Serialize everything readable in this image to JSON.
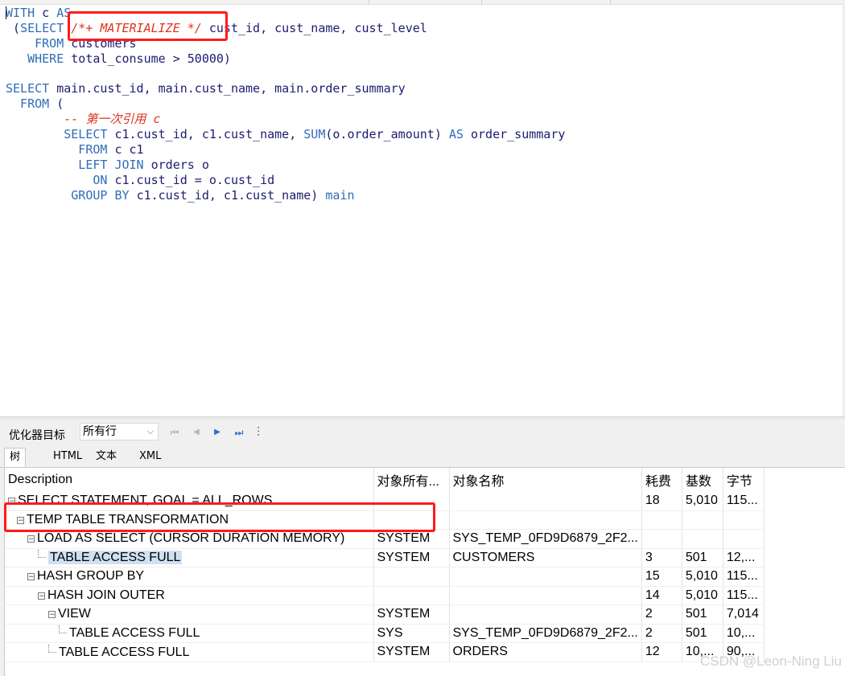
{
  "editor": {
    "lines": [
      [
        {
          "t": "WITH ",
          "c": "kw"
        },
        {
          "t": "c ",
          "c": "id"
        },
        {
          "t": "AS",
          "c": "kw"
        }
      ],
      [
        {
          "t": " (",
          "c": "id"
        },
        {
          "t": "SELECT ",
          "c": "kw"
        },
        {
          "t": "/*+ MATERIALIZE */",
          "c": "cm"
        },
        {
          "t": " cust_id, cust_name, cust_level",
          "c": "id"
        }
      ],
      [
        {
          "t": "    FROM ",
          "c": "kw"
        },
        {
          "t": "customers",
          "c": "id"
        }
      ],
      [
        {
          "t": "   WHERE ",
          "c": "kw"
        },
        {
          "t": "total_consume > 50000)",
          "c": "id"
        }
      ],
      [
        {
          "t": "",
          "c": "id"
        }
      ],
      [
        {
          "t": "SELECT ",
          "c": "kw"
        },
        {
          "t": "main.cust_id, main.cust_name, main.order_summary",
          "c": "id"
        }
      ],
      [
        {
          "t": "  FROM ",
          "c": "kw"
        },
        {
          "t": "(",
          "c": "id"
        }
      ],
      [
        {
          "t": "        -- 第一次引用 c",
          "c": "cm"
        }
      ],
      [
        {
          "t": "        SELECT ",
          "c": "kw"
        },
        {
          "t": "c1.cust_id, c1.cust_name, ",
          "c": "id"
        },
        {
          "t": "SUM",
          "c": "fn"
        },
        {
          "t": "(o.order_amount) ",
          "c": "id"
        },
        {
          "t": "AS ",
          "c": "kw"
        },
        {
          "t": "order_summary",
          "c": "id"
        }
      ],
      [
        {
          "t": "          FROM ",
          "c": "kw"
        },
        {
          "t": "c c1",
          "c": "id"
        }
      ],
      [
        {
          "t": "          LEFT JOIN ",
          "c": "kw"
        },
        {
          "t": "orders o",
          "c": "id"
        }
      ],
      [
        {
          "t": "            ON ",
          "c": "kw"
        },
        {
          "t": "c1.cust_id = o.cust_id",
          "c": "id"
        }
      ],
      [
        {
          "t": "         GROUP BY ",
          "c": "kw"
        },
        {
          "t": "c1.cust_id, c1.cust_name) ",
          "c": "id"
        },
        {
          "t": "main",
          "c": "kw"
        }
      ]
    ]
  },
  "toolbar": {
    "optimizer_label": "优化器目标",
    "optimizer_value": "所有行",
    "chevron_glyph": "⌵",
    "first_glyph": "⏮",
    "prev_glyph": "◀",
    "next_glyph": "▶",
    "last_glyph": "⏭",
    "settings_glyph": "⫶"
  },
  "tabs": [
    "树",
    "HTML",
    "文本",
    "XML"
  ],
  "plan": {
    "columns": [
      "Description",
      "对象所有...",
      "对象名称",
      "耗费",
      "基数",
      "字节"
    ],
    "rows": [
      {
        "depth": 0,
        "node": "minus",
        "desc": "SELECT STATEMENT, GOAL = ALL_ROWS",
        "owner": "",
        "name": "",
        "cost": "18",
        "card": "5,010",
        "bytes": "115...",
        "hl": false
      },
      {
        "depth": 1,
        "node": "minus",
        "desc": "TEMP TABLE TRANSFORMATION",
        "owner": "",
        "name": "",
        "cost": "",
        "card": "",
        "bytes": "",
        "hl": false
      },
      {
        "depth": 2,
        "node": "minus",
        "desc": "LOAD AS SELECT (CURSOR DURATION MEMORY)",
        "owner": "SYSTEM",
        "name": "SYS_TEMP_0FD9D6879_2F2...",
        "cost": "",
        "card": "",
        "bytes": "",
        "hl": false
      },
      {
        "depth": 3,
        "node": "leaf",
        "desc": "TABLE ACCESS FULL",
        "owner": "SYSTEM",
        "name": "CUSTOMERS",
        "cost": "3",
        "card": "501",
        "bytes": "12,...",
        "hl": true
      },
      {
        "depth": 2,
        "node": "minus",
        "desc": "HASH GROUP BY",
        "owner": "",
        "name": "",
        "cost": "15",
        "card": "5,010",
        "bytes": "115...",
        "hl": false
      },
      {
        "depth": 3,
        "node": "minus",
        "desc": "HASH JOIN OUTER",
        "owner": "",
        "name": "",
        "cost": "14",
        "card": "5,010",
        "bytes": "115...",
        "hl": false
      },
      {
        "depth": 4,
        "node": "minus",
        "desc": "VIEW",
        "owner": "SYSTEM",
        "name": "",
        "cost": "2",
        "card": "501",
        "bytes": "7,014",
        "hl": false
      },
      {
        "depth": 5,
        "node": "leaf",
        "desc": "TABLE ACCESS FULL",
        "owner": "SYS",
        "name": "SYS_TEMP_0FD9D6879_2F2...",
        "cost": "2",
        "card": "501",
        "bytes": "10,...",
        "hl": false
      },
      {
        "depth": 4,
        "node": "leaf",
        "desc": "TABLE ACCESS FULL",
        "owner": "SYSTEM",
        "name": "ORDERS",
        "cost": "12",
        "card": "10,...",
        "bytes": "90,...",
        "hl": false
      }
    ]
  },
  "watermark": "CSDN @Leon-Ning Liu"
}
